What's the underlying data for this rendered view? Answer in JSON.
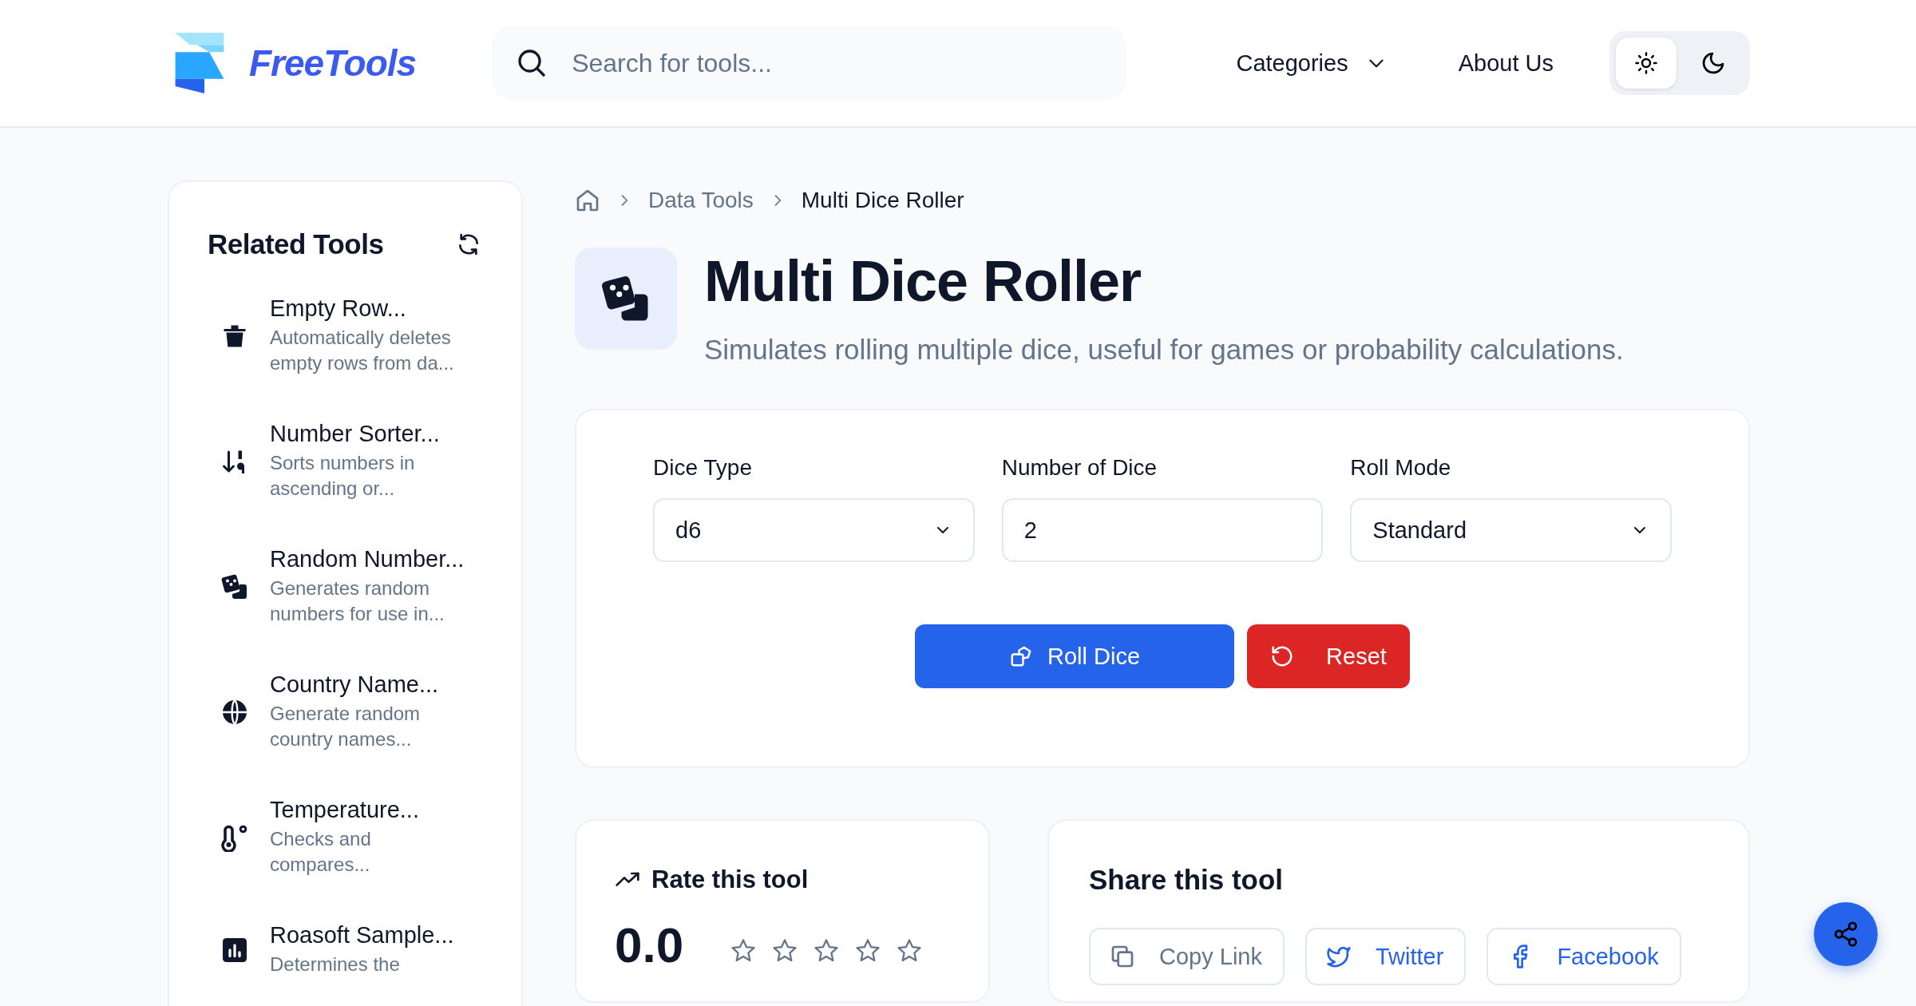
{
  "header": {
    "logo": "FreeTools",
    "search": {
      "placeholder": "Search for tools..."
    },
    "nav": [
      {
        "label": "Categories",
        "kind": "dropdown"
      },
      {
        "label": "About Us",
        "kind": "link"
      }
    ],
    "theme_toggle": [
      {
        "kind": "light",
        "selected": true
      },
      {
        "kind": "dark",
        "selected": false
      }
    ]
  },
  "sidebar": {
    "title": "Related Tools",
    "items": [
      {
        "kind": "trash",
        "title": "Empty Row...",
        "description": "Automatically deletes empty rows from da..."
      },
      {
        "kind": "sort",
        "title": "Number Sorter...",
        "description": "Sorts numbers in ascending or..."
      },
      {
        "kind": "dice",
        "title": "Random Number...",
        "description": "Generates random numbers for use in..."
      },
      {
        "kind": "globe",
        "title": "Country Name...",
        "description": "Generate random country names..."
      },
      {
        "kind": "thermometer",
        "title": "Temperature...",
        "description": "Checks and compares..."
      },
      {
        "kind": "chart",
        "title": "Roasoft Sample...",
        "description": "Determines the"
      }
    ]
  },
  "breadcrumb": [
    {
      "kind": "home"
    },
    {
      "label": "Data Tools"
    },
    {
      "label": "Multi Dice Roller"
    }
  ],
  "tool": {
    "title": "Multi Dice Roller",
    "subtitle": "Simulates rolling multiple dice, useful for games or probability calculations."
  },
  "form": {
    "fields": [
      {
        "label": "Dice Type",
        "kind": "select",
        "value": "d6"
      },
      {
        "label": "Number of Dice",
        "kind": "input",
        "value": "2"
      },
      {
        "label": "Roll Mode",
        "kind": "select",
        "value": "Standard"
      }
    ],
    "buttons": [
      {
        "label": "Roll Dice",
        "kind": "primary"
      },
      {
        "label": "Reset",
        "kind": "danger"
      }
    ]
  },
  "rating": {
    "title": "Rate this tool",
    "score": "0.0",
    "stars": 0
  },
  "share": {
    "title": "Share this tool",
    "buttons": [
      {
        "label": "Copy Link",
        "kind": "copy"
      },
      {
        "label": "Twitter",
        "kind": "twitter"
      },
      {
        "label": "Facebook",
        "kind": "facebook"
      }
    ]
  }
}
